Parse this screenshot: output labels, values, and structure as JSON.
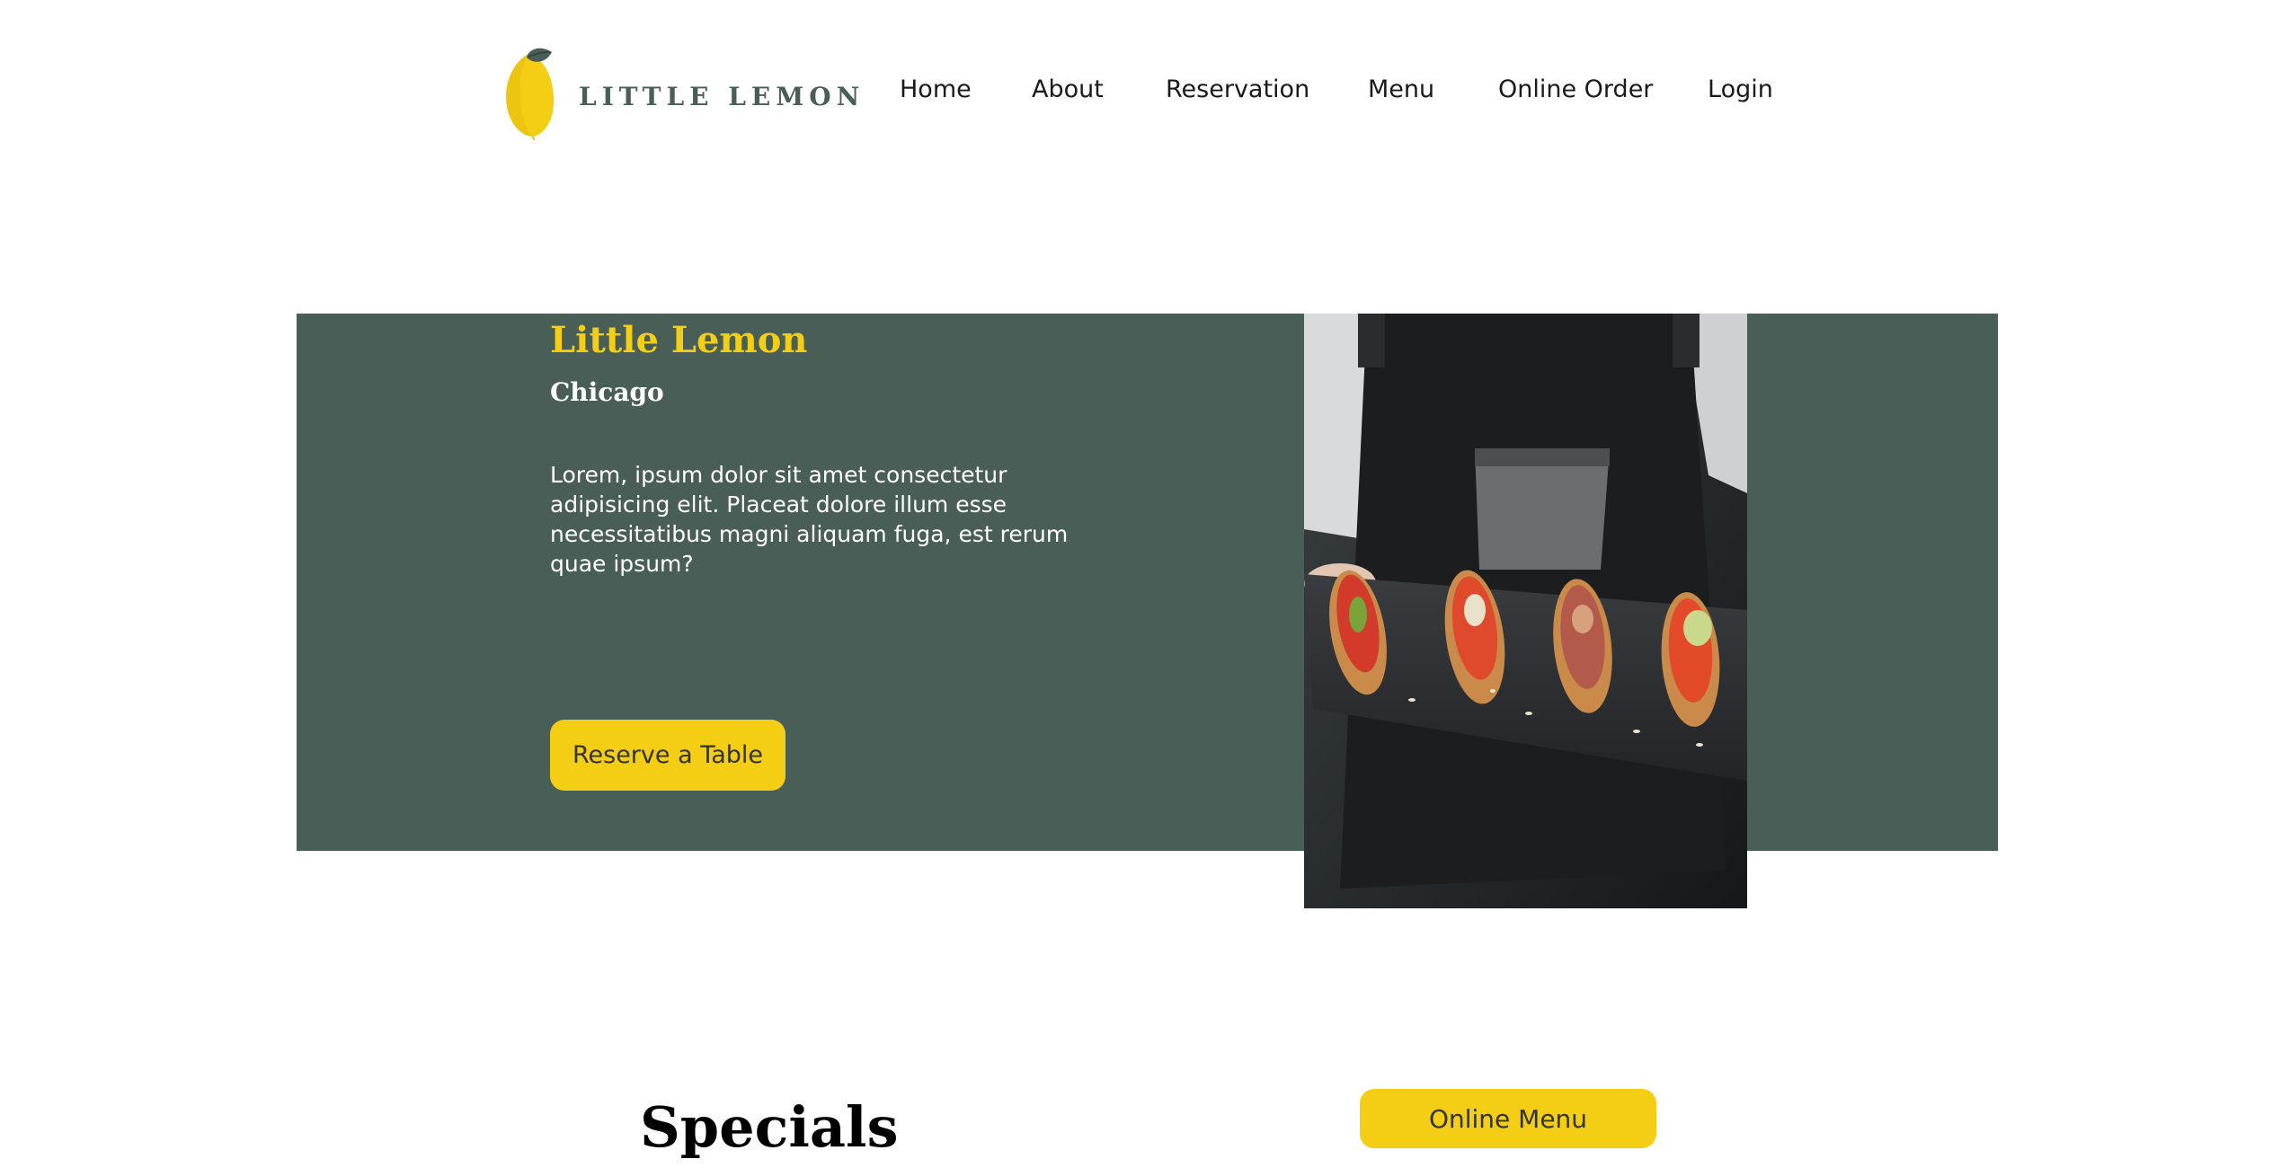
{
  "header": {
    "logo_text": "LITTLE LEMON",
    "logo_icon": "lemon-icon",
    "nav": [
      {
        "label": "Home"
      },
      {
        "label": "About"
      },
      {
        "label": "Reservation"
      },
      {
        "label": "Menu"
      },
      {
        "label": "Online Order"
      },
      {
        "label": "Login"
      }
    ]
  },
  "hero": {
    "title": "Little Lemon",
    "subtitle": "Chicago",
    "description": "Lorem, ipsum dolor sit amet consectetur adipisicing elit. Placeat dolore illum esse necessitatibus magni aliquam fuga, est rerum quae ipsum?",
    "reserve_label": "Reserve a Table"
  },
  "specials": {
    "title": "Specials",
    "online_menu_label": "Online Menu"
  },
  "colors": {
    "primary_green": "#495e57",
    "primary_yellow": "#f4ce14",
    "text_dark": "#333333",
    "background": "#ffffff"
  }
}
